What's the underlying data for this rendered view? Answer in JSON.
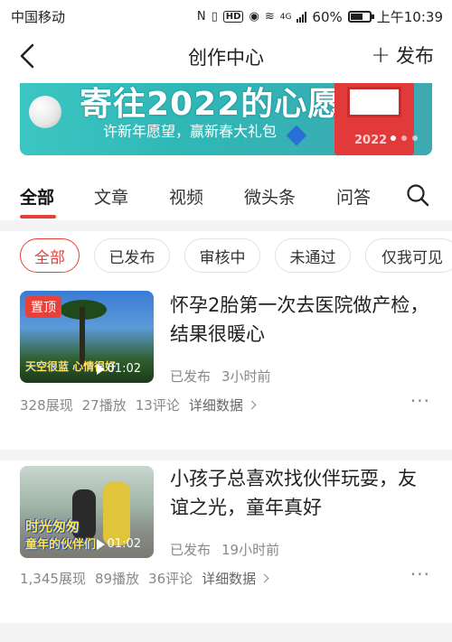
{
  "status_bar": {
    "carrier": "中国移动",
    "battery": "60%",
    "time": "上午10:39",
    "network": "4G"
  },
  "nav": {
    "title": "创作中心",
    "publish_label": "发布",
    "publish_icon": "plus-icon",
    "back_icon": "chevron-left-icon"
  },
  "banner": {
    "headline": "寄往2022的心愿",
    "subtitle": "许新年愿望，赢新春大礼包",
    "mailbox_year": "2022"
  },
  "tabs": {
    "items": [
      "全部",
      "文章",
      "视频",
      "微头条",
      "问答"
    ],
    "active_index": 0,
    "search_icon": "search-icon",
    "accent_color": "#e8413a"
  },
  "filters": {
    "items": [
      "全部",
      "已发布",
      "审核中",
      "未通过",
      "仅我可见"
    ],
    "active_index": 0
  },
  "posts": [
    {
      "pinned_label": "置顶",
      "title": "怀孕2胎第一次去医院做产检，结果很暖心",
      "status": "已发布",
      "time": "3小时前",
      "duration": "01:02",
      "thumb_caption": "天空很蓝 心情很好",
      "views": "328展现",
      "plays": "27播放",
      "comments": "13评论",
      "details_label": "详细数据"
    },
    {
      "title": "小孩子总喜欢找伙伴玩耍，友谊之光，童年真好",
      "status": "已发布",
      "time": "19小时前",
      "duration": "01:02",
      "thumb_caption_line1": "时光匆匆",
      "thumb_caption_line2": "童年的伙伴们",
      "views": "1,345展现",
      "plays": "89播放",
      "comments": "36评论",
      "details_label": "详细数据"
    }
  ]
}
